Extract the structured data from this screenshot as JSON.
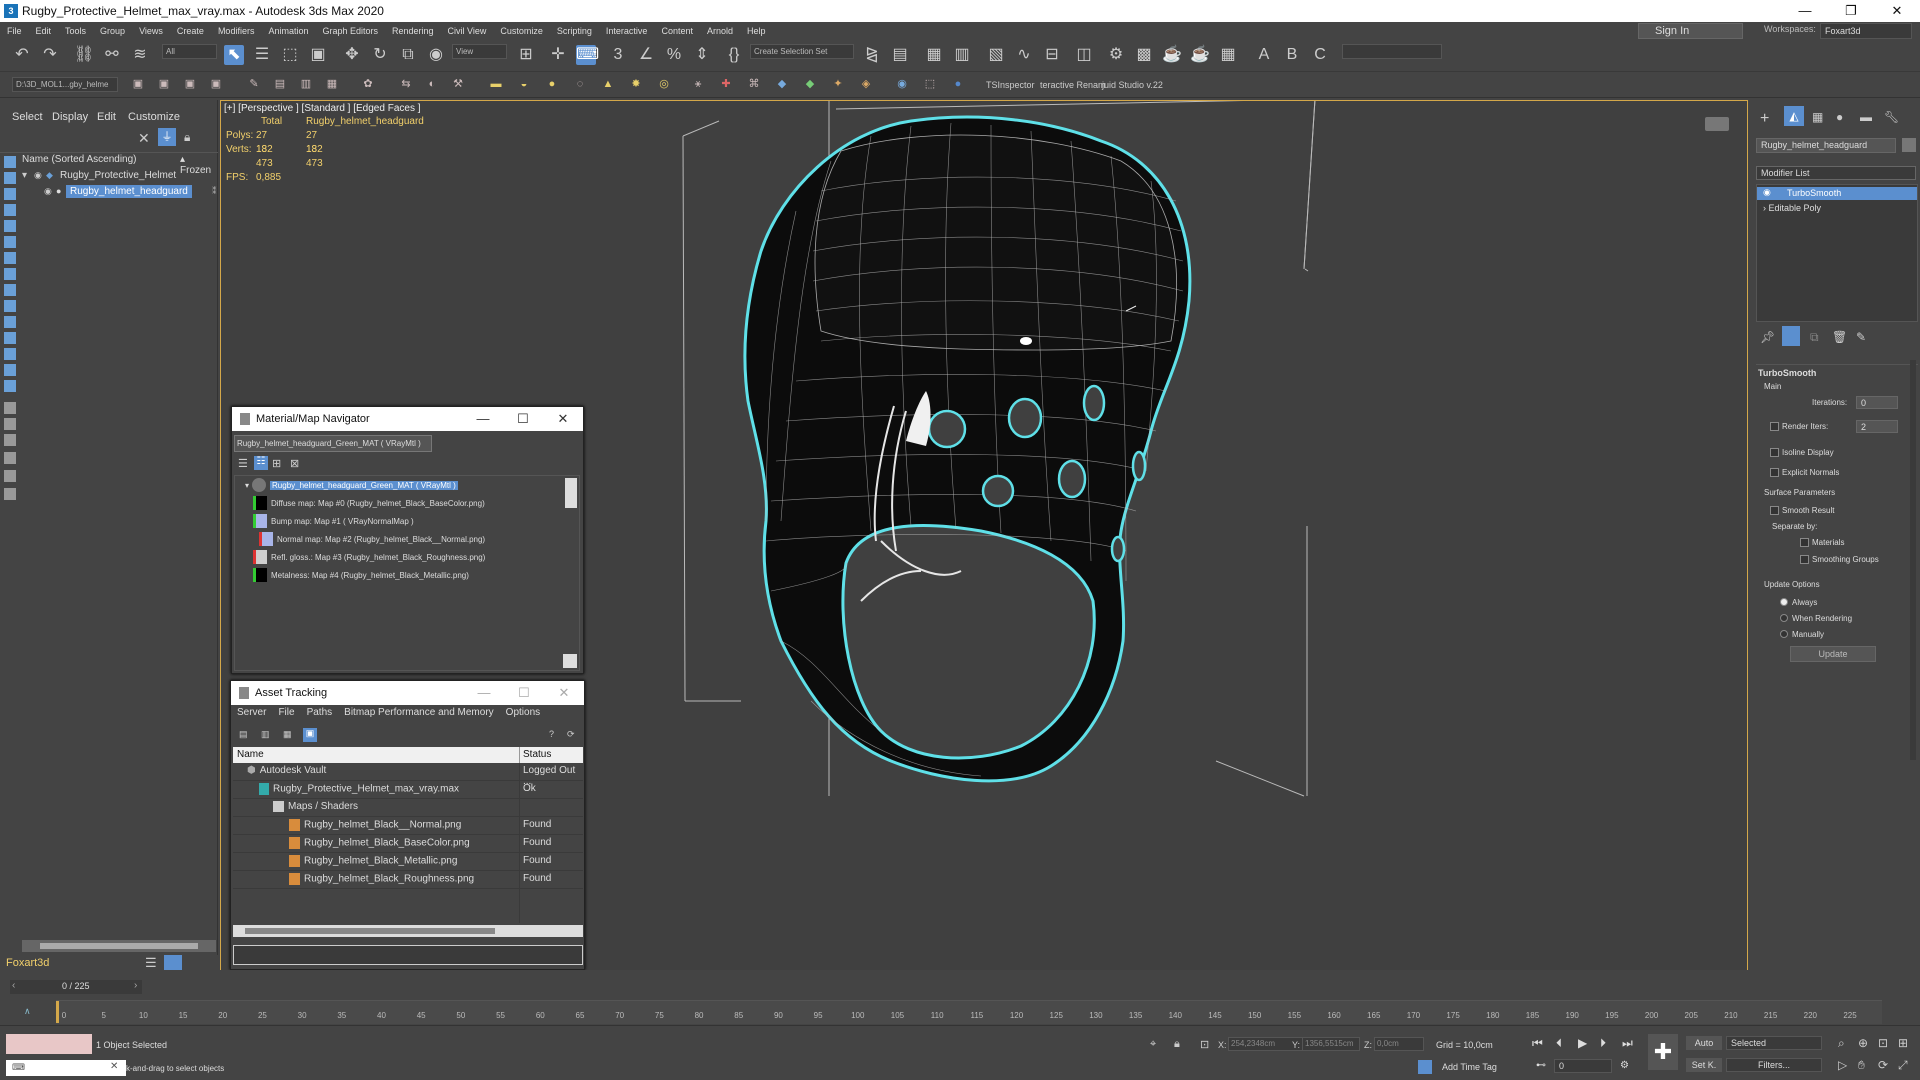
{
  "window": {
    "title": "Rugby_Protective_Helmet_max_vray.max - Autodesk 3ds Max 2020",
    "app_icon": "3",
    "buttons": [
      "—",
      "❐",
      "✕"
    ]
  },
  "menu": {
    "items": [
      "File",
      "Edit",
      "Tools",
      "Group",
      "Views",
      "Create",
      "Modifiers",
      "Animation",
      "Graph Editors",
      "Rendering",
      "Civil View",
      "Customize",
      "Scripting",
      "Interactive",
      "Content",
      "Arnold",
      "Help"
    ],
    "sign_in": "Sign In",
    "workspaces_label": "Workspaces:",
    "workspace_value": "Foxart3d"
  },
  "toolbar": {
    "filter_combo": "All",
    "view_combo": "View",
    "selection_set": "Create Selection Set",
    "path_combo": "D:\\3D_MOL1...gby_helme",
    "tsinspector": "TSInspector",
    "interactive_rename": "teractive Renam",
    "guid_studio": "juid Studio v.22"
  },
  "scene_explorer": {
    "tabs": [
      "Select",
      "Display",
      "Edit",
      "Customize"
    ],
    "column": "Name (Sorted Ascending)",
    "frozen": "▴ Frozen",
    "items": [
      "Rugby_Protective_Helmet",
      "Rugby_helmet_headguard"
    ],
    "layer": "Foxart3d",
    "frame": "0 / 225"
  },
  "viewport": {
    "label": "[+] [Perspective ] [Standard ] [Edged Faces ]",
    "stats": {
      "h_total": "Total",
      "h_obj": "Rugby_helmet_headguard",
      "polys_label": "Polys:",
      "polys_total": "27 182",
      "polys_obj": "27 182",
      "verts_label": "Verts:",
      "verts_total": "13 473",
      "verts_obj": "13 473",
      "fps_label": "FPS:",
      "fps": "0,885"
    }
  },
  "material_navigator": {
    "title": "Material/Map Navigator",
    "current": "Rugby_helmet_headguard_Green_MAT  ( VRayMtl )",
    "rows": [
      "Rugby_helmet_headguard_Green_MAT  ( VRayMtl )",
      "Diffuse map: Map #0 (Rugby_helmet_Black_BaseColor.png)",
      "Bump map: Map #1  ( VRayNormalMap )",
      "Normal map: Map #2 (Rugby_helmet_Black__Normal.png)",
      "Refl. gloss.: Map #3 (Rugby_helmet_Black_Roughness.png)",
      "Metalness: Map #4 (Rugby_helmet_Black_Metallic.png)"
    ]
  },
  "asset_tracking": {
    "title": "Asset Tracking",
    "menu": [
      "Server",
      "File",
      "Paths",
      "Bitmap Performance and Memory",
      "Options"
    ],
    "col_name": "Name",
    "col_status": "Status",
    "rows": [
      {
        "name": "Autodesk Vault",
        "status": "Logged Out ..."
      },
      {
        "name": "Rugby_Protective_Helmet_max_vray.max",
        "status": "Ok"
      },
      {
        "name": "Maps / Shaders",
        "status": ""
      },
      {
        "name": "Rugby_helmet_Black__Normal.png",
        "status": "Found"
      },
      {
        "name": "Rugby_helmet_Black_BaseColor.png",
        "status": "Found"
      },
      {
        "name": "Rugby_helmet_Black_Metallic.png",
        "status": "Found"
      },
      {
        "name": "Rugby_helmet_Black_Roughness.png",
        "status": "Found"
      }
    ]
  },
  "command_panel": {
    "object_name": "Rugby_helmet_headguard",
    "modifier_list": "Modifier List",
    "stack": [
      "TurboSmooth",
      "Editable Poly"
    ],
    "rollout_title": "TurboSmooth",
    "main": "Main",
    "iterations_label": "Iterations:",
    "iterations": "0",
    "render_iters_label": "Render Iters:",
    "render_iters": "2",
    "isoline": "Isoline Display",
    "explicit_normals": "Explicit Normals",
    "surface_params": "Surface Parameters",
    "smooth_result": "Smooth Result",
    "separate_by": "Separate by:",
    "materials": "Materials",
    "smoothing_groups": "Smoothing Groups",
    "update_options": "Update Options",
    "always": "Always",
    "when_rendering": "When Rendering",
    "manually": "Manually",
    "update": "Update"
  },
  "timeline": {
    "ticks": [
      "0",
      "5",
      "10",
      "15",
      "20",
      "25",
      "30",
      "35",
      "40",
      "45",
      "50",
      "55",
      "60",
      "65",
      "70",
      "75",
      "80",
      "85",
      "90",
      "95",
      "100",
      "105",
      "110",
      "115",
      "120",
      "125",
      "130",
      "135",
      "140",
      "145",
      "150",
      "155",
      "160",
      "165",
      "170",
      "175",
      "180",
      "185",
      "190",
      "195",
      "200",
      "205",
      "210",
      "215",
      "220",
      "225"
    ]
  },
  "status": {
    "selected": "1 Object Selected",
    "hint": "k-and-drag to select objects",
    "x_label": "X:",
    "x": "254,2348cm",
    "y_label": "Y:",
    "y": "1356,5515cm",
    "z_label": "Z:",
    "z": "0,0cm",
    "grid": "Grid = 10,0cm",
    "add_time_tag": "Add Time Tag",
    "auto": "Auto",
    "selected_combo": "Selected",
    "set_k": "Set K.",
    "filters": "Filters...",
    "frame_field": "0"
  },
  "colors": {
    "accent": "#5b8fcf",
    "viewport_border": "#d4a84a",
    "stats": "#f2d06b",
    "wire_highlight": "#5fe0e8"
  }
}
